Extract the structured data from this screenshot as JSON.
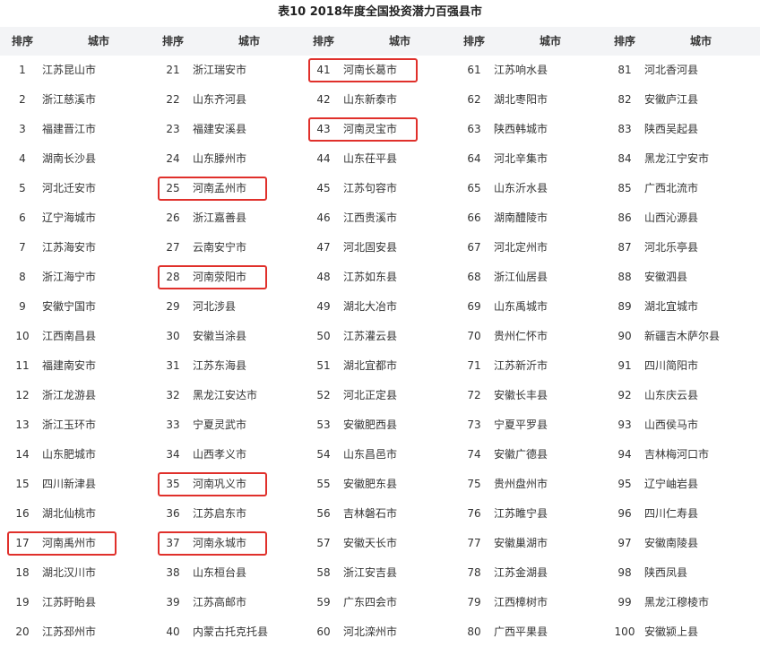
{
  "title": "表10 2018年度全国投资潜力百强县市",
  "headers": {
    "rank": "排序",
    "city": "城市"
  },
  "highlight_color": "#e0302b",
  "rows": [
    [
      {
        "rank": "1",
        "city": "江苏昆山市"
      },
      {
        "rank": "21",
        "city": "浙江瑞安市"
      },
      {
        "rank": "41",
        "city": "河南长葛市",
        "hl": true
      },
      {
        "rank": "61",
        "city": "江苏响水县"
      },
      {
        "rank": "81",
        "city": "河北香河县"
      }
    ],
    [
      {
        "rank": "2",
        "city": "浙江慈溪市"
      },
      {
        "rank": "22",
        "city": "山东齐河县"
      },
      {
        "rank": "42",
        "city": "山东新泰市"
      },
      {
        "rank": "62",
        "city": "湖北枣阳市"
      },
      {
        "rank": "82",
        "city": "安徽庐江县"
      }
    ],
    [
      {
        "rank": "3",
        "city": "福建晋江市"
      },
      {
        "rank": "23",
        "city": "福建安溪县"
      },
      {
        "rank": "43",
        "city": "河南灵宝市",
        "hl": true
      },
      {
        "rank": "63",
        "city": "陕西韩城市"
      },
      {
        "rank": "83",
        "city": "陕西吴起县"
      }
    ],
    [
      {
        "rank": "4",
        "city": "湖南长沙县"
      },
      {
        "rank": "24",
        "city": "山东滕州市"
      },
      {
        "rank": "44",
        "city": "山东茌平县"
      },
      {
        "rank": "64",
        "city": "河北辛集市"
      },
      {
        "rank": "84",
        "city": "黑龙江宁安市"
      }
    ],
    [
      {
        "rank": "5",
        "city": "河北迁安市"
      },
      {
        "rank": "25",
        "city": "河南孟州市",
        "hl": true
      },
      {
        "rank": "45",
        "city": "江苏句容市"
      },
      {
        "rank": "65",
        "city": "山东沂水县"
      },
      {
        "rank": "85",
        "city": "广西北流市"
      }
    ],
    [
      {
        "rank": "6",
        "city": "辽宁海城市"
      },
      {
        "rank": "26",
        "city": "浙江嘉善县"
      },
      {
        "rank": "46",
        "city": "江西贵溪市"
      },
      {
        "rank": "66",
        "city": "湖南醴陵市"
      },
      {
        "rank": "86",
        "city": "山西沁源县"
      }
    ],
    [
      {
        "rank": "7",
        "city": "江苏海安市"
      },
      {
        "rank": "27",
        "city": "云南安宁市"
      },
      {
        "rank": "47",
        "city": "河北固安县"
      },
      {
        "rank": "67",
        "city": "河北定州市"
      },
      {
        "rank": "87",
        "city": "河北乐亭县"
      }
    ],
    [
      {
        "rank": "8",
        "city": "浙江海宁市"
      },
      {
        "rank": "28",
        "city": "河南荥阳市",
        "hl": true
      },
      {
        "rank": "48",
        "city": "江苏如东县"
      },
      {
        "rank": "68",
        "city": "浙江仙居县"
      },
      {
        "rank": "88",
        "city": "安徽泗县"
      }
    ],
    [
      {
        "rank": "9",
        "city": "安徽宁国市"
      },
      {
        "rank": "29",
        "city": "河北涉县"
      },
      {
        "rank": "49",
        "city": "湖北大冶市"
      },
      {
        "rank": "69",
        "city": "山东禹城市"
      },
      {
        "rank": "89",
        "city": "湖北宜城市"
      }
    ],
    [
      {
        "rank": "10",
        "city": "江西南昌县"
      },
      {
        "rank": "30",
        "city": "安徽当涂县"
      },
      {
        "rank": "50",
        "city": "江苏灌云县"
      },
      {
        "rank": "70",
        "city": "贵州仁怀市"
      },
      {
        "rank": "90",
        "city": "新疆吉木萨尔县"
      }
    ],
    [
      {
        "rank": "11",
        "city": "福建南安市"
      },
      {
        "rank": "31",
        "city": "江苏东海县"
      },
      {
        "rank": "51",
        "city": "湖北宜都市"
      },
      {
        "rank": "71",
        "city": "江苏新沂市"
      },
      {
        "rank": "91",
        "city": "四川简阳市"
      }
    ],
    [
      {
        "rank": "12",
        "city": "浙江龙游县"
      },
      {
        "rank": "32",
        "city": "黑龙江安达市"
      },
      {
        "rank": "52",
        "city": "河北正定县"
      },
      {
        "rank": "72",
        "city": "安徽长丰县"
      },
      {
        "rank": "92",
        "city": "山东庆云县"
      }
    ],
    [
      {
        "rank": "13",
        "city": "浙江玉环市"
      },
      {
        "rank": "33",
        "city": "宁夏灵武市"
      },
      {
        "rank": "53",
        "city": "安徽肥西县"
      },
      {
        "rank": "73",
        "city": "宁夏平罗县"
      },
      {
        "rank": "93",
        "city": "山西侯马市"
      }
    ],
    [
      {
        "rank": "14",
        "city": "山东肥城市"
      },
      {
        "rank": "34",
        "city": "山西孝义市"
      },
      {
        "rank": "54",
        "city": "山东昌邑市"
      },
      {
        "rank": "74",
        "city": "安徽广德县"
      },
      {
        "rank": "94",
        "city": "吉林梅河口市"
      }
    ],
    [
      {
        "rank": "15",
        "city": "四川新津县"
      },
      {
        "rank": "35",
        "city": "河南巩义市",
        "hl": true
      },
      {
        "rank": "55",
        "city": "安徽肥东县"
      },
      {
        "rank": "75",
        "city": "贵州盘州市"
      },
      {
        "rank": "95",
        "city": "辽宁岫岩县"
      }
    ],
    [
      {
        "rank": "16",
        "city": "湖北仙桃市"
      },
      {
        "rank": "36",
        "city": "江苏启东市"
      },
      {
        "rank": "56",
        "city": "吉林磐石市"
      },
      {
        "rank": "76",
        "city": "江苏睢宁县"
      },
      {
        "rank": "96",
        "city": "四川仁寿县"
      }
    ],
    [
      {
        "rank": "17",
        "city": "河南禹州市",
        "hl": true
      },
      {
        "rank": "37",
        "city": "河南永城市",
        "hl": true
      },
      {
        "rank": "57",
        "city": "安徽天长市"
      },
      {
        "rank": "77",
        "city": "安徽巢湖市"
      },
      {
        "rank": "97",
        "city": "安徽南陵县"
      }
    ],
    [
      {
        "rank": "18",
        "city": "湖北汉川市"
      },
      {
        "rank": "38",
        "city": "山东桓台县"
      },
      {
        "rank": "58",
        "city": "浙江安吉县"
      },
      {
        "rank": "78",
        "city": "江苏金湖县"
      },
      {
        "rank": "98",
        "city": "陕西凤县"
      }
    ],
    [
      {
        "rank": "19",
        "city": "江苏盱眙县"
      },
      {
        "rank": "39",
        "city": "江苏高邮市"
      },
      {
        "rank": "59",
        "city": "广东四会市"
      },
      {
        "rank": "79",
        "city": "江西樟树市"
      },
      {
        "rank": "99",
        "city": "黑龙江穆棱市"
      }
    ],
    [
      {
        "rank": "20",
        "city": "江苏邳州市"
      },
      {
        "rank": "40",
        "city": "内蒙古托克托县"
      },
      {
        "rank": "60",
        "city": "河北滦州市"
      },
      {
        "rank": "80",
        "city": "广西平果县"
      },
      {
        "rank": "100",
        "city": "安徽颍上县"
      }
    ]
  ]
}
